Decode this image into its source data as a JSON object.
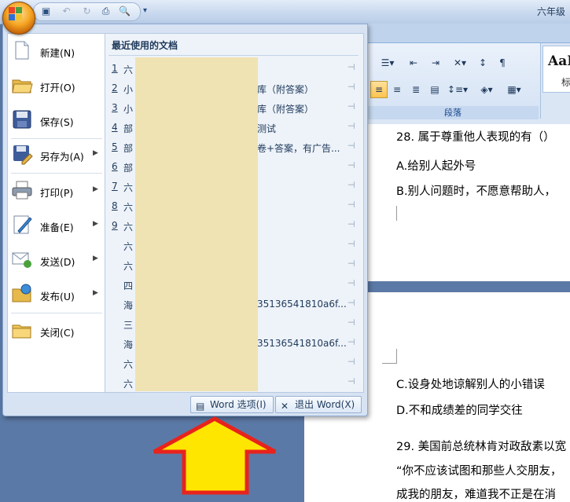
{
  "window": {
    "title": "六年级"
  },
  "quick_access": {
    "icons": [
      "save-icon",
      "undo-icon",
      "redo-icon",
      "print-icon",
      "print-preview-icon"
    ],
    "more": "▾"
  },
  "ribbon": {
    "group_label": "段落",
    "styles_sample": "AaI",
    "styles_caption": "标"
  },
  "menu": {
    "items": [
      {
        "label": "新建(N)",
        "icon": "new-document-icon",
        "submenu": false
      },
      {
        "label": "打开(O)",
        "icon": "open-folder-icon",
        "submenu": false
      },
      {
        "label": "保存(S)",
        "icon": "save-icon",
        "submenu": false
      },
      {
        "label": "另存为(A)",
        "icon": "save-as-icon",
        "submenu": true
      },
      {
        "label": "打印(P)",
        "icon": "print-icon",
        "submenu": true
      },
      {
        "label": "准备(E)",
        "icon": "prepare-icon",
        "submenu": true
      },
      {
        "label": "发送(D)",
        "icon": "send-icon",
        "submenu": true
      },
      {
        "label": "发布(U)",
        "icon": "publish-icon",
        "submenu": true
      },
      {
        "label": "关闭(C)",
        "icon": "close-folder-icon",
        "submenu": false
      }
    ],
    "recent_title": "最近使用的文档",
    "recent": [
      {
        "num": "1",
        "name": "六",
        "tail": ""
      },
      {
        "num": "2",
        "name": "小",
        "tail": "库（附答案）"
      },
      {
        "num": "3",
        "name": "小",
        "tail": "库（附答案）"
      },
      {
        "num": "4",
        "name": "部",
        "tail": "测试"
      },
      {
        "num": "5",
        "name": "部",
        "tail": "卷+答案，有广告..."
      },
      {
        "num": "6",
        "name": "部",
        "tail": ""
      },
      {
        "num": "7",
        "name": "六",
        "tail": ""
      },
      {
        "num": "8",
        "name": "六",
        "tail": ""
      },
      {
        "num": "9",
        "name": "六",
        "tail": ""
      },
      {
        "num": "",
        "name": "六",
        "tail": ""
      },
      {
        "num": "",
        "name": "六",
        "tail": ""
      },
      {
        "num": "",
        "name": "四",
        "tail": ""
      },
      {
        "num": "",
        "name": "海",
        "tail": "35136541810a6f..."
      },
      {
        "num": "",
        "name": "三",
        "tail": ""
      },
      {
        "num": "",
        "name": "海",
        "tail": "35136541810a6f..."
      },
      {
        "num": "",
        "name": "六",
        "tail": ""
      },
      {
        "num": "",
        "name": "六",
        "tail": ""
      }
    ],
    "word_options": "Word 选项(I)",
    "exit_word": "退出 Word(X)"
  },
  "document": {
    "lines_top": [
      "28. 属于尊重他人表现的有（）",
      "A.给别人起外号",
      "B.别人问题时，不愿意帮助人，"
    ],
    "lines_bottom": [
      "C.设身处地谅解别人的小错误",
      "D.不和成绩差的同学交往",
      "29. 美国前总统林肯对政敌素以宽",
      "“你不应该试图和那些人交朋友，",
      "成我的朋友，难道我不正是在消"
    ]
  },
  "colors": {
    "accent": "#ffe600",
    "arrow_border": "#e8231c",
    "menu_bg": "#d7e3f3"
  }
}
